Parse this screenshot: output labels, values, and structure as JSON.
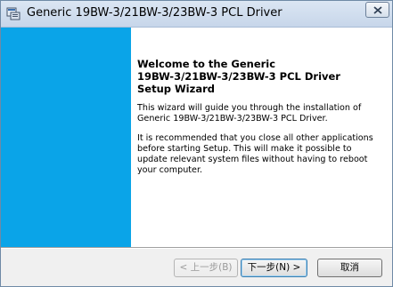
{
  "window": {
    "title": "Generic 19BW-3/21BW-3/23BW-3 PCL Driver"
  },
  "welcome": {
    "heading": "Welcome to the Generic\n19BW-3/21BW-3/23BW-3 PCL Driver\nSetup Wizard",
    "paragraph1": "This wizard will guide you through the installation of\nGeneric 19BW-3/21BW-3/23BW-3 PCL Driver.",
    "paragraph2": "It is recommended that you close all other applications\nbefore starting Setup. This will make it possible to\nupdate relevant system files without having to reboot\nyour computer."
  },
  "buttons": {
    "back": "< 上一步(B)",
    "next": "下一步(N) >",
    "cancel": "取消"
  },
  "colors": {
    "side_panel": "#0aa4e8",
    "content_background": "#ffffff",
    "footer_background": "#f0f0f0"
  }
}
